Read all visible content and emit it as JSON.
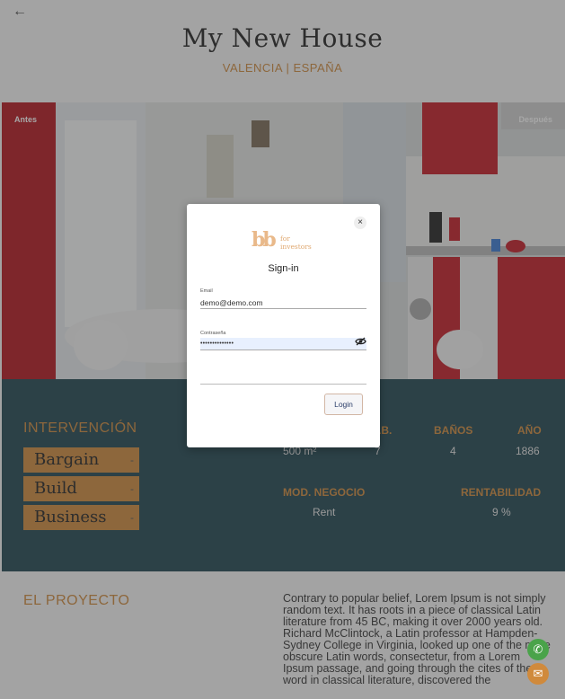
{
  "header": {
    "title": "My New House",
    "subtitle": "VALENCIA | ESPAÑA"
  },
  "hero": {
    "before_label": "Antes",
    "after_label": "Después"
  },
  "info": {
    "intervencion_title": "INTERVENCIÓN",
    "tags": [
      "Bargain",
      "Build",
      "Business"
    ],
    "tag_dash": "-",
    "stats": {
      "hab_header": "HAB.",
      "banos_header": "BAÑOS",
      "ano_header": "AÑO",
      "area_value": "500 m²",
      "hab_value": "7",
      "banos_value": "4",
      "ano_value": "1886",
      "modelo_header": "MOD. NEGOCIO",
      "rentabilidad_header": "RENTABILIDAD",
      "modelo_value": "Rent",
      "rentabilidad_value": "9 %"
    }
  },
  "proyecto": {
    "title": "EL PROYECTO",
    "text": "Contrary to popular belief, Lorem Ipsum is not simply random text. It has roots in a piece of classical Latin literature from 45 BC, making it over 2000 years old. Richard McClintock, a Latin professor at Hampden-Sydney College in Virginia, looked up one of the more obscure Latin words, consectetur, from a Lorem Ipsum passage, and going through the cites of the word in classical literature, discovered the"
  },
  "modal": {
    "logo_mark": "bb",
    "logo_for": "for",
    "logo_investors": "investors",
    "title": "Sign-in",
    "email_label": "Email",
    "email_value": "demo@demo.com",
    "password_label": "Contraseña",
    "password_value": "••••••••••••••",
    "close_glyph": "×",
    "login_label": "Login"
  },
  "icons": {
    "back": "arrow-left-icon",
    "close": "close-icon",
    "eye": "eye-off-icon",
    "phone": "phone-icon",
    "mail": "mail-icon"
  },
  "colors": {
    "accent": "#d08a3c",
    "dark_section": "#1f4550",
    "phone_button": "#4aa34a"
  }
}
